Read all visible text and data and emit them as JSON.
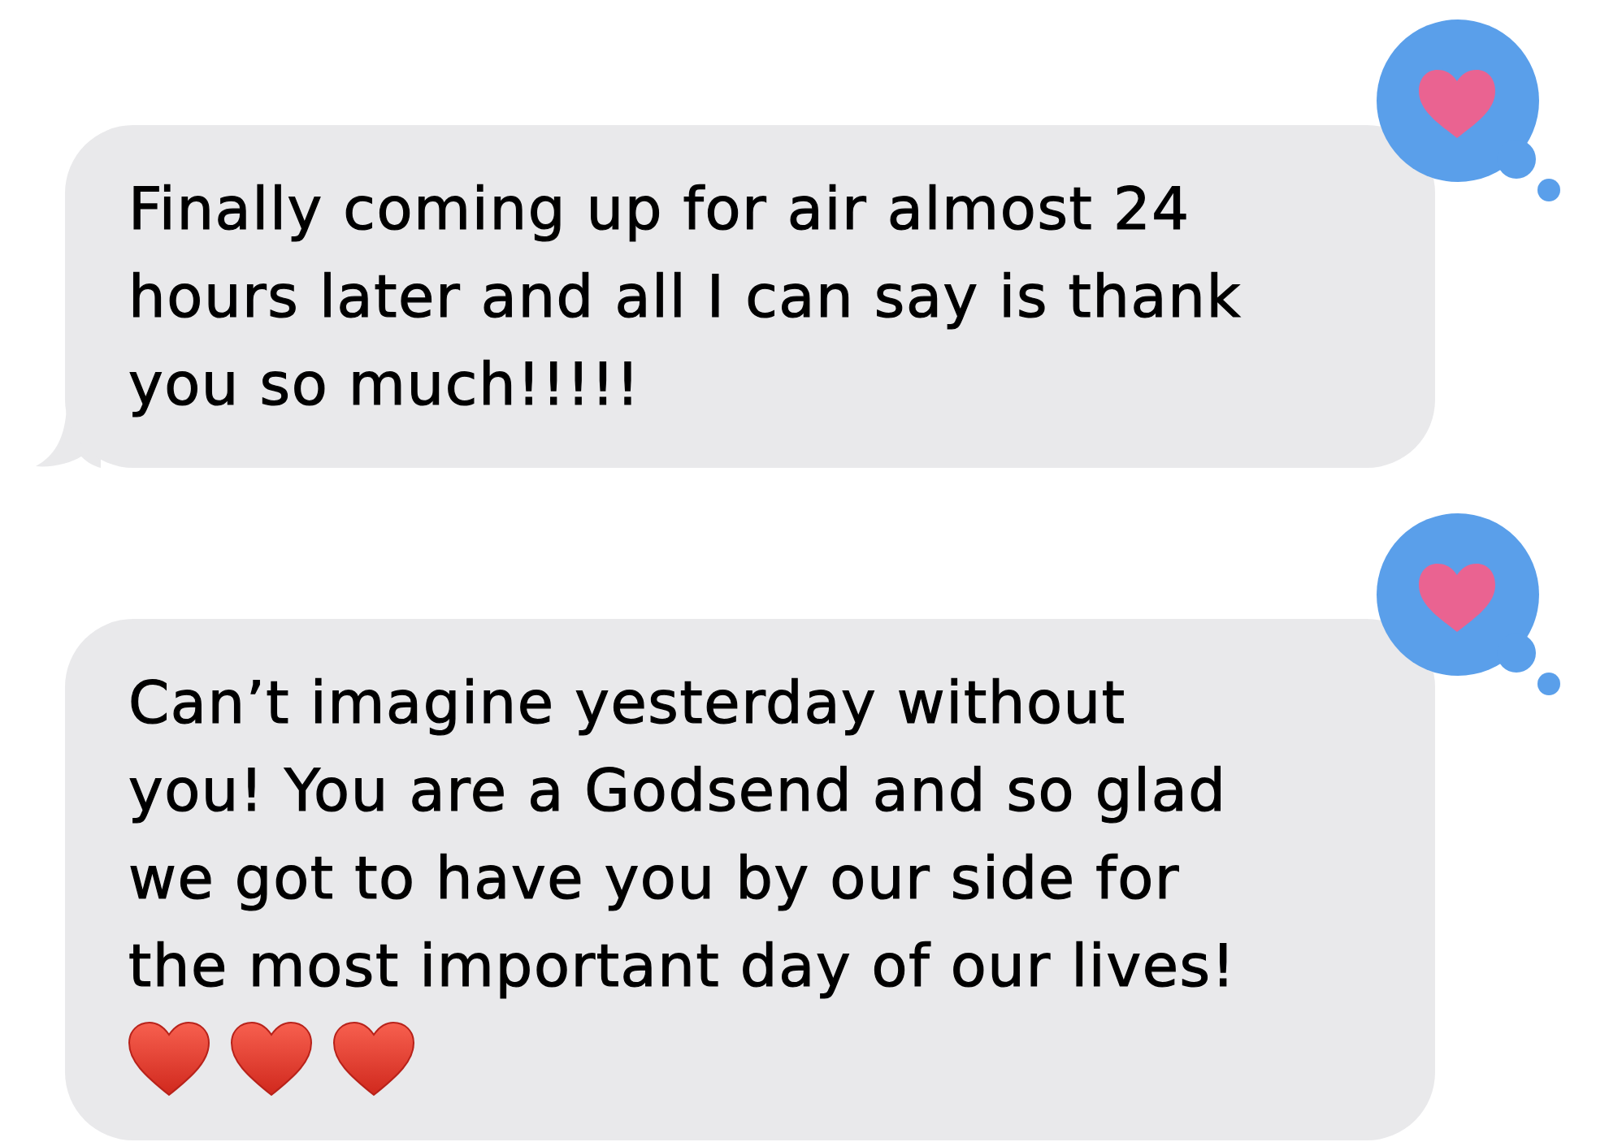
{
  "messages": [
    {
      "text": "Finally coming up for air almost 24\nhours later and all I can say is thank\nyou so much!!!!!",
      "tail": true,
      "reaction": {
        "kind": "heart"
      }
    },
    {
      "text": "Can’t imagine yesterday without\nyou! You are a Godsend and so glad\nwe got to have you by our side for\nthe most important day of our lives!",
      "tail": false,
      "reaction": {
        "kind": "heart"
      },
      "emojis": [
        {
          "kind": "heart"
        },
        {
          "kind": "heart"
        },
        {
          "kind": "heart"
        }
      ]
    }
  ]
}
